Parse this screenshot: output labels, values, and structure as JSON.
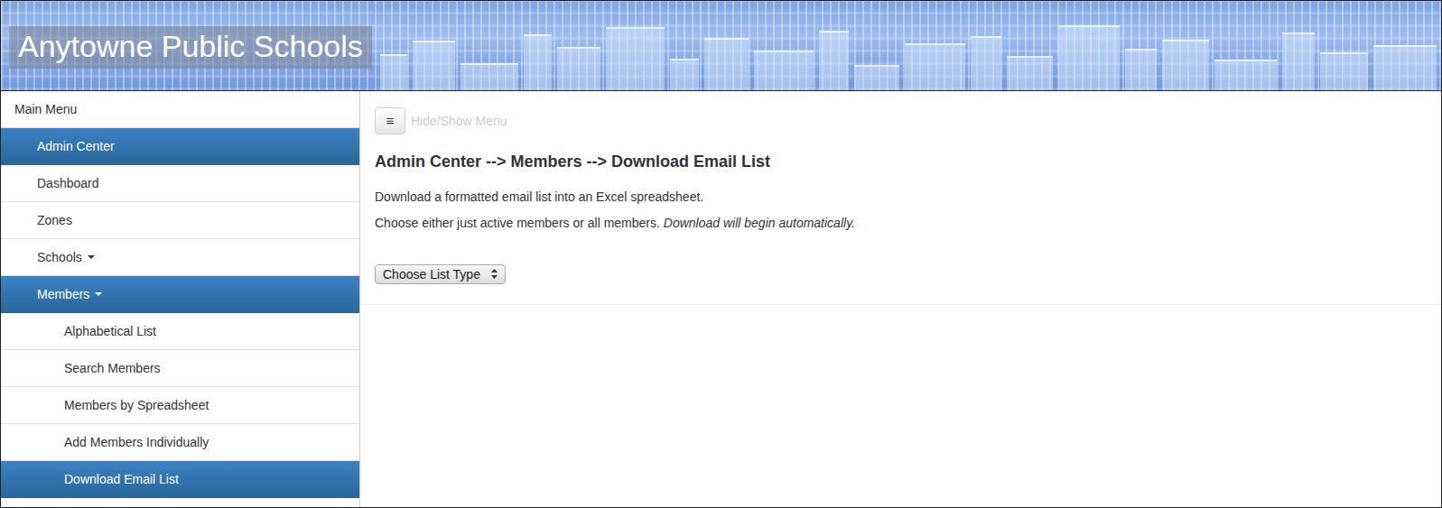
{
  "header": {
    "title": "Anytowne Public Schools"
  },
  "sidebar": {
    "items": [
      {
        "label": "Main Menu",
        "kind": "heading",
        "selected": false,
        "has_submenu": false
      },
      {
        "label": "Admin Center",
        "kind": "item",
        "selected": true,
        "has_submenu": false
      },
      {
        "label": "Dashboard",
        "kind": "item",
        "selected": false,
        "has_submenu": false
      },
      {
        "label": "Zones",
        "kind": "item",
        "selected": false,
        "has_submenu": false
      },
      {
        "label": "Schools",
        "kind": "item",
        "selected": false,
        "has_submenu": true
      },
      {
        "label": "Members",
        "kind": "item",
        "selected": true,
        "has_submenu": true
      },
      {
        "label": "Alphabetical List",
        "kind": "subitem",
        "selected": false,
        "has_submenu": false
      },
      {
        "label": "Search Members",
        "kind": "subitem",
        "selected": false,
        "has_submenu": false
      },
      {
        "label": "Members by Spreadsheet",
        "kind": "subitem",
        "selected": false,
        "has_submenu": false
      },
      {
        "label": "Add Members Individually",
        "kind": "subitem",
        "selected": false,
        "has_submenu": false
      },
      {
        "label": "Download Email List",
        "kind": "subitem",
        "selected": true,
        "has_submenu": false
      }
    ]
  },
  "toolbar": {
    "icon": "≡",
    "label": "Hide/Show Menu"
  },
  "content": {
    "heading": "Admin Center --> Members --> Download Email List",
    "intro": "Download a formatted email list into an Excel spreadsheet.",
    "choice": {
      "text": "Choose either just active members or all members.",
      "emphasis": "Download will begin automatically."
    },
    "select": {
      "value": "Choose List Type"
    }
  }
}
